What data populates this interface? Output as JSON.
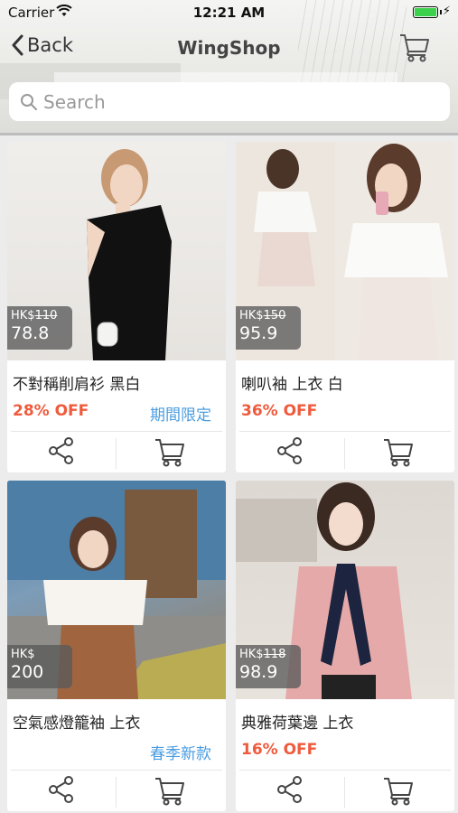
{
  "status_bar": {
    "carrier": "Carrier",
    "time": "12:21 AM"
  },
  "nav": {
    "back_label": "Back",
    "title": "WingShop"
  },
  "search": {
    "placeholder": "Search"
  },
  "colors": {
    "discount": "#f05a3c",
    "tag": "#4a9de0",
    "battery": "#3bd14b"
  },
  "products": [
    {
      "name": "不對稱削肩衫 黑白",
      "currency": "HK$",
      "original_price": "110",
      "price": "78.8",
      "discount": "28% OFF",
      "tag": "期間限定"
    },
    {
      "name": "喇叭袖 上衣 白",
      "currency": "HK$",
      "original_price": "150",
      "price": "95.9",
      "discount": "36% OFF",
      "tag": ""
    },
    {
      "name": "空氣感燈籠袖 上衣",
      "currency": "HK$",
      "original_price": "",
      "price": "200",
      "discount": "",
      "tag": "春季新款"
    },
    {
      "name": "典雅荷葉邊 上衣",
      "currency": "HK$",
      "original_price": "118",
      "price": "98.9",
      "discount": "16% OFF",
      "tag": ""
    }
  ],
  "icons": {
    "back": "chevron-left-icon",
    "cart": "cart-icon",
    "share": "share-icon",
    "search": "search-icon"
  }
}
